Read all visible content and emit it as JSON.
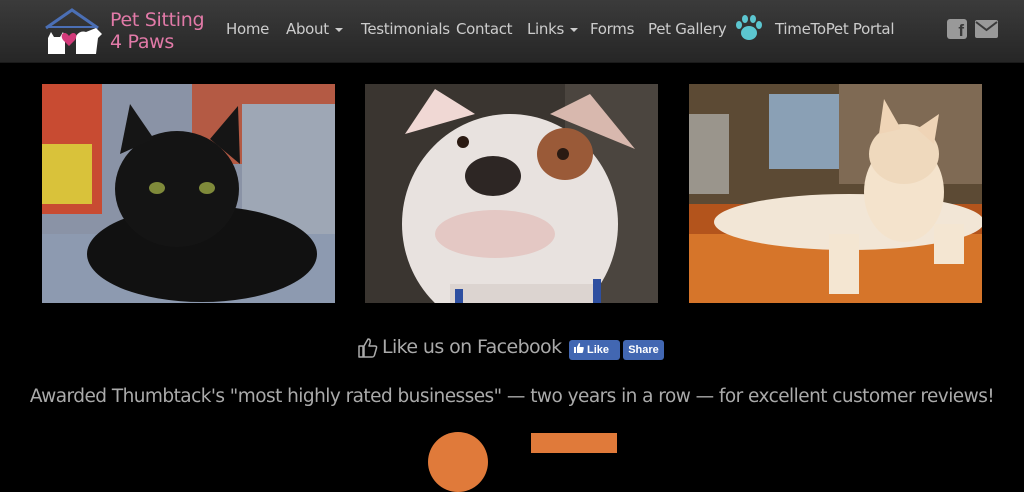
{
  "brand": {
    "line1": "Pet Sitting",
    "line2": "4 Paws",
    "color": "#e27aa8"
  },
  "nav": {
    "items": [
      {
        "label": "Home"
      },
      {
        "label": "About",
        "dropdown": true
      },
      {
        "label": "Testimonials"
      },
      {
        "label": "Contact"
      },
      {
        "label": "Links",
        "dropdown": true
      },
      {
        "label": "Forms"
      },
      {
        "label": "Pet Gallery"
      },
      {
        "label": "TimeToPet Portal",
        "icon": "paw-icon"
      }
    ],
    "social": [
      "facebook-icon",
      "envelope-icon"
    ]
  },
  "photos": [
    {
      "subject": "black cat"
    },
    {
      "subject": "white and brown dog"
    },
    {
      "subject": "cream cat"
    }
  ],
  "facebook": {
    "like_text": "Like us on Facebook",
    "like_button": "Like",
    "share_button": "Share",
    "button_color": "#4267b2"
  },
  "award_text": "Awarded Thumbtack's \"most highly rated businesses\" — two years in a row — for excellent customer reviews!",
  "accent_color": "#e07a3a"
}
